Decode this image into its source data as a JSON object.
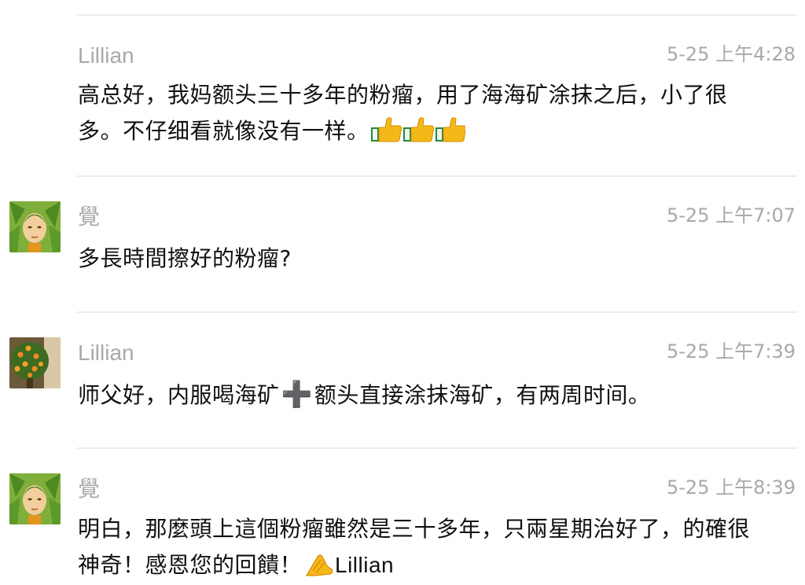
{
  "messages": [
    {
      "name": "Lillian",
      "time": "5-25 上午4:28",
      "text_before": "高总好，我妈额头三十多年的粉瘤，用了海海矿涂抹之后，小了很多。不仔细看就像没有一样。",
      "emoji": "thumbs-up-icon ×3",
      "avatar": "none"
    },
    {
      "name": "覺",
      "time": "5-25 上午7:07",
      "text": "多長時間擦好的粉瘤?",
      "avatar": "green-leaf-portrait-avatar"
    },
    {
      "name": "Lillian",
      "time": "5-25 上午7:39",
      "text_before": "师父好，内服喝海矿",
      "plus": "➕",
      "text_after": "额头直接涂抹海矿，有两周时间。",
      "avatar": "orange-tree-avatar"
    },
    {
      "name": "覺",
      "time": "5-25 上午8:39",
      "text_before": "明白，那麼頭上這個粉瘤雖然是三十多年，只兩星期治好了，的確很神奇！感恩您的回饋！",
      "text_after": "Lillian",
      "emoji": "folded-hands-icon",
      "avatar": "green-leaf-portrait-avatar"
    }
  ],
  "colors": {
    "name": "#a9a9a9",
    "time": "#a9a9a9",
    "text": "#111111",
    "divider": "#ececec",
    "plus": "#8a5cc8"
  }
}
